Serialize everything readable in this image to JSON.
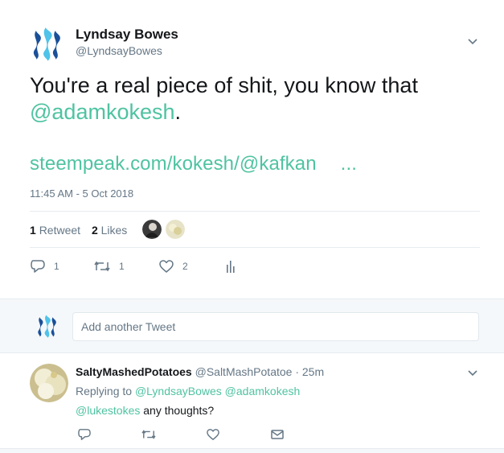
{
  "tweet": {
    "author_name": "Lyndsay Bowes",
    "author_handle": "@LyndsayBowes",
    "text_main": "You're a real piece of shit, you know that",
    "text_mention": "@adamkokesh",
    "text_period": ".",
    "link": "steempeak.com/kokesh/@kafkan",
    "link_ellipsis": "...",
    "timestamp": "11:45 AM - 5 Oct 2018",
    "retweets_count": "1",
    "retweets_label": "Retweet",
    "likes_count": "2",
    "likes_label": "Likes",
    "actions": {
      "reply_count": "1",
      "retweet_count": "1",
      "like_count": "2"
    }
  },
  "reply_box": {
    "placeholder": "Add another Tweet"
  },
  "reply": {
    "author_name": "SaltyMashedPotatoes",
    "author_handle": "@SaltMashPotatoe",
    "time": "· 25m",
    "replying_prefix": "Replying to",
    "replying_users": "@LyndsayBowes @adamkokesh",
    "text_mention": "@lukestokes",
    "text_rest": "any thoughts?"
  },
  "colors": {
    "accent": "#4fc3a1",
    "steem_blue": "#1a5099",
    "text_secondary": "#657786"
  },
  "icons": [
    "steem-logo-icon",
    "chevron-down-icon",
    "reply-icon",
    "retweet-icon",
    "heart-icon",
    "analytics-icon",
    "mail-icon"
  ]
}
